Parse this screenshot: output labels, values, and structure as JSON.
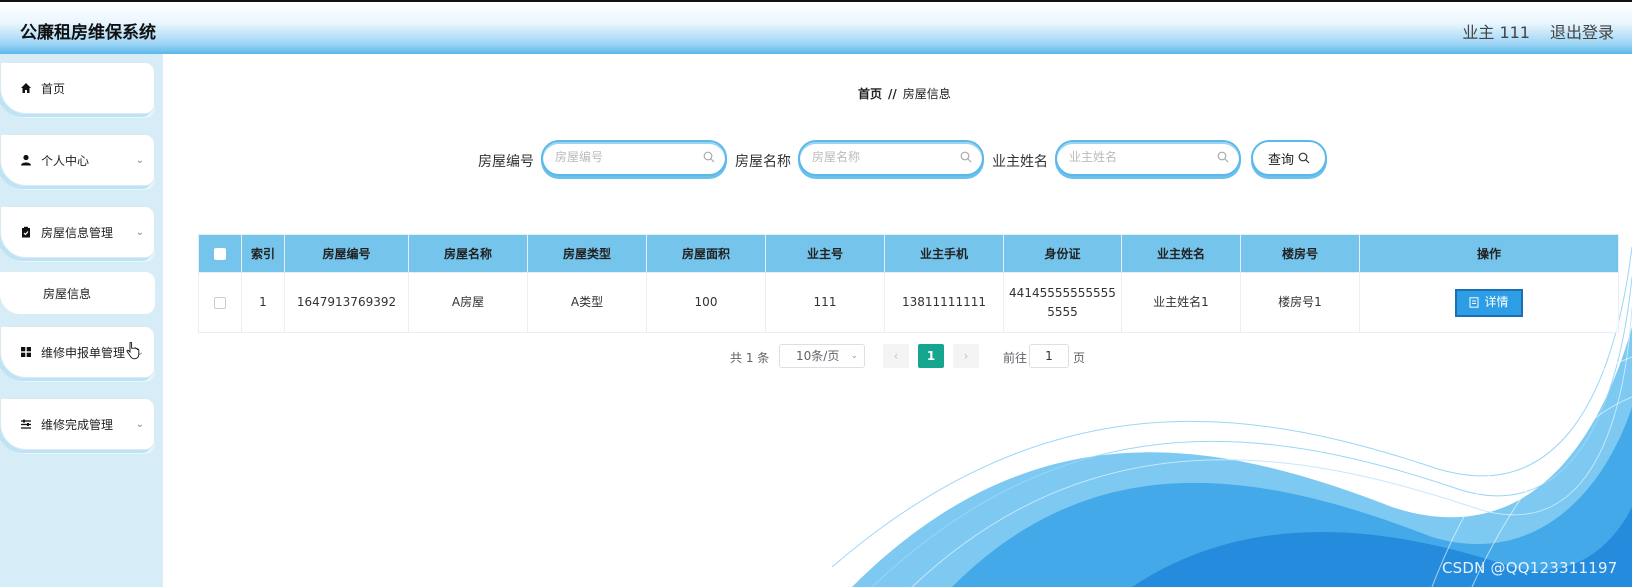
{
  "header": {
    "title": "公廉租房维保系统",
    "user": "业主 111",
    "logout": "退出登录"
  },
  "sidebar": {
    "items": [
      {
        "label": "首页",
        "icon": "home-icon"
      },
      {
        "label": "个人中心",
        "icon": "user-icon"
      },
      {
        "label": "房屋信息管理",
        "icon": "clipboard-icon"
      },
      {
        "label": "维修申报单管理",
        "icon": "grid-icon"
      },
      {
        "label": "维修完成管理",
        "icon": "sliders-icon"
      }
    ],
    "sub_item": "房屋信息"
  },
  "breadcrumb": {
    "home": "首页",
    "separator": "//",
    "current": "房屋信息"
  },
  "search": {
    "fields": [
      {
        "label": "房屋编号",
        "placeholder": "房屋编号"
      },
      {
        "label": "房屋名称",
        "placeholder": "房屋名称"
      },
      {
        "label": "业主姓名",
        "placeholder": "业主姓名"
      }
    ],
    "button": "查询"
  },
  "table": {
    "columns": [
      "索引",
      "房屋编号",
      "房屋名称",
      "房屋类型",
      "房屋面积",
      "业主号",
      "业主手机",
      "身份证",
      "业主姓名",
      "楼房号",
      "操作"
    ],
    "rows": [
      {
        "index": "1",
        "code": "1647913769392",
        "name": "A房屋",
        "type": "A类型",
        "area": "100",
        "owner_no": "111",
        "phone": "13811111111",
        "id_card_1": "44145555555555",
        "id_card_2": "5555",
        "owner_name": "业主姓名1",
        "building": "楼房号1",
        "action": "详情"
      }
    ]
  },
  "pagination": {
    "total": "共 1 条",
    "page_size": "10条/页",
    "current": "1",
    "goto": "前往",
    "goto_value": "1",
    "page_unit": "页"
  },
  "watermark": "CSDN @QQ123311197",
  "colors": {
    "header_accent": "#5bb6ea",
    "table_header": "#75c4ec",
    "active_page": "#16a58e",
    "detail_button": "#2d9de5"
  }
}
